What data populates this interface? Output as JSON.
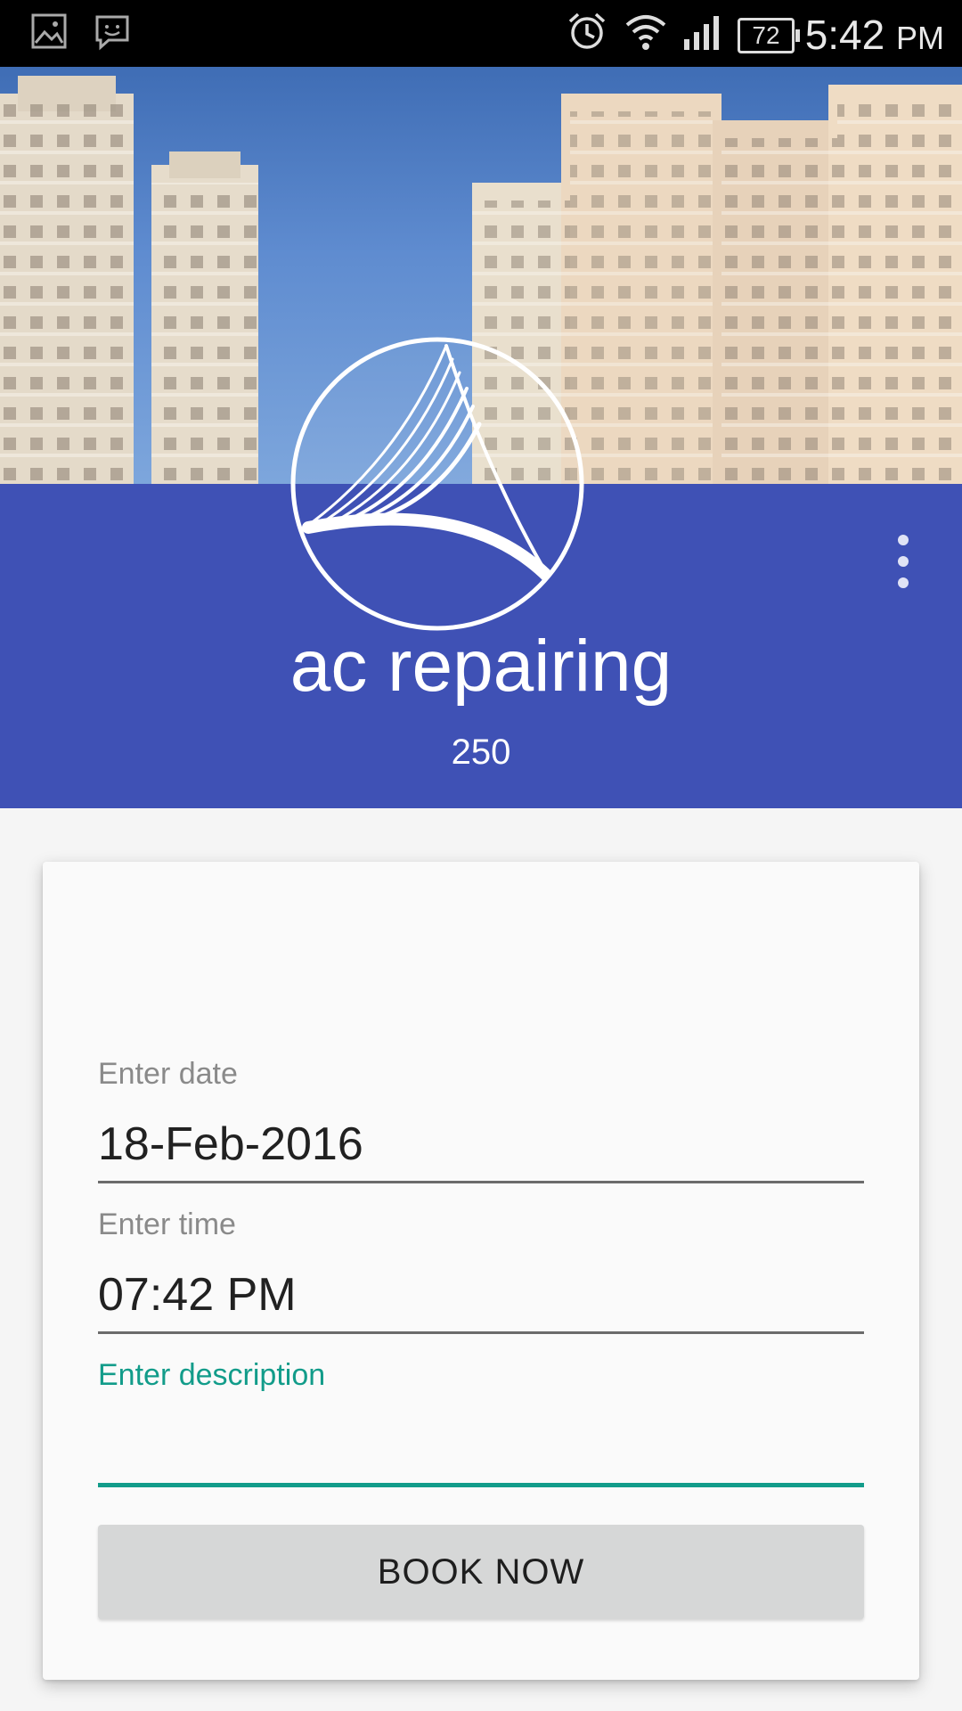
{
  "status_bar": {
    "time": "5:42",
    "ampm": "PM",
    "battery": "72",
    "icons": [
      "image-icon",
      "chat-icon",
      "alarm-icon",
      "wifi-icon",
      "signal-icon",
      "battery-icon"
    ]
  },
  "header": {
    "title": "ac repairing",
    "price": "250",
    "band_color": "#3f51b5"
  },
  "form": {
    "date_label": "Enter date",
    "date_value": "18-Feb-2016",
    "time_label": "Enter time",
    "time_value": "07:42 PM",
    "description_label": "Enter description",
    "description_value": "",
    "accent_color": "#129c8a",
    "book_button": "BOOK NOW"
  }
}
